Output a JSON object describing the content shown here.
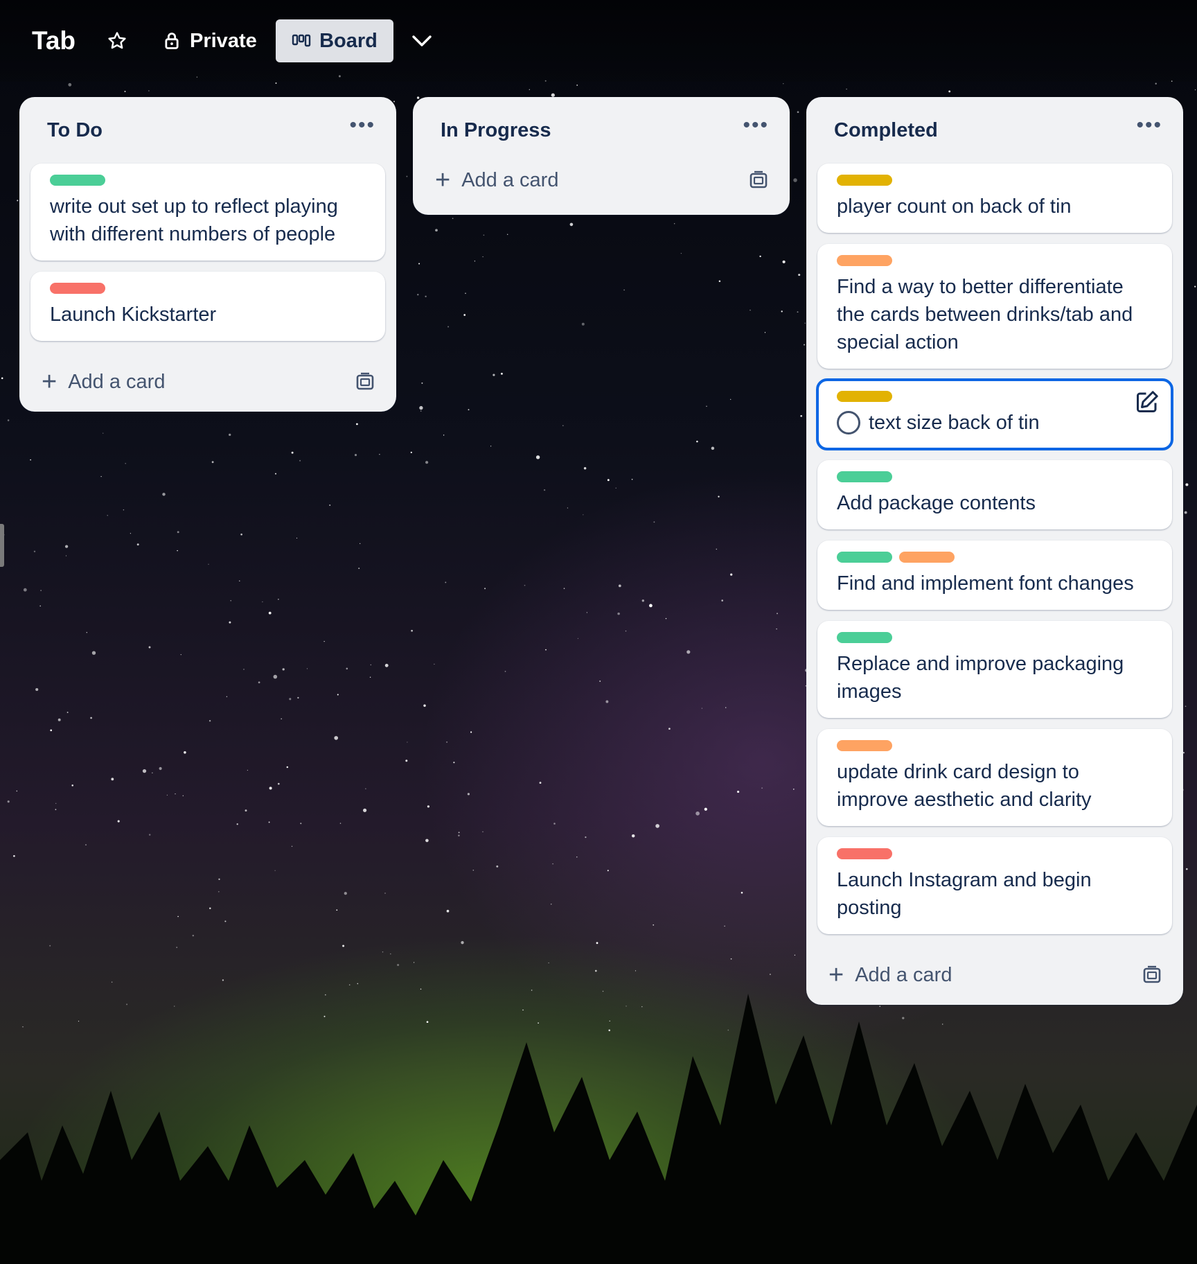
{
  "board": {
    "title": "Tab",
    "visibility": "Private",
    "view": "Board",
    "icons": {
      "star": "star-icon",
      "visibility": "lock-icon",
      "view": "board-view-icon",
      "dropdown": "chevron-down-icon"
    }
  },
  "colors": {
    "green": "#4bce97",
    "yellow": "#e2b203",
    "orange": "#fea362",
    "red": "#f87168",
    "active_outline": "#0c66e4",
    "list_bg": "#f1f2f4"
  },
  "lists": [
    {
      "title": "To Do",
      "add_label": "Add a card",
      "cards": [
        {
          "labels": [
            "green"
          ],
          "text": "write out set up to reflect playing with different numbers of people"
        },
        {
          "labels": [
            "red"
          ],
          "text": "Launch Kickstarter"
        }
      ]
    },
    {
      "title": "In Progress",
      "add_label": "Add a card",
      "cards": []
    },
    {
      "title": "Completed",
      "add_label": "Add a card",
      "cards": [
        {
          "labels": [
            "yellow"
          ],
          "text": "player count on back of tin"
        },
        {
          "labels": [
            "orange"
          ],
          "text": "Find a way to better differentiate the cards between drinks/tab and special action"
        },
        {
          "labels": [
            "yellow"
          ],
          "text": "text size back of tin",
          "active": true
        },
        {
          "labels": [
            "green"
          ],
          "text": "Add package contents"
        },
        {
          "labels": [
            "green",
            "orange"
          ],
          "text": "Find and implement font changes"
        },
        {
          "labels": [
            "green"
          ],
          "text": "Replace and improve packaging images"
        },
        {
          "labels": [
            "orange"
          ],
          "text": "update drink card design to improve aesthetic and clarity"
        },
        {
          "labels": [
            "red"
          ],
          "text": "Launch Instagram and begin posting"
        }
      ]
    }
  ],
  "list_menu_glyph": "•••",
  "add_glyph": "+"
}
